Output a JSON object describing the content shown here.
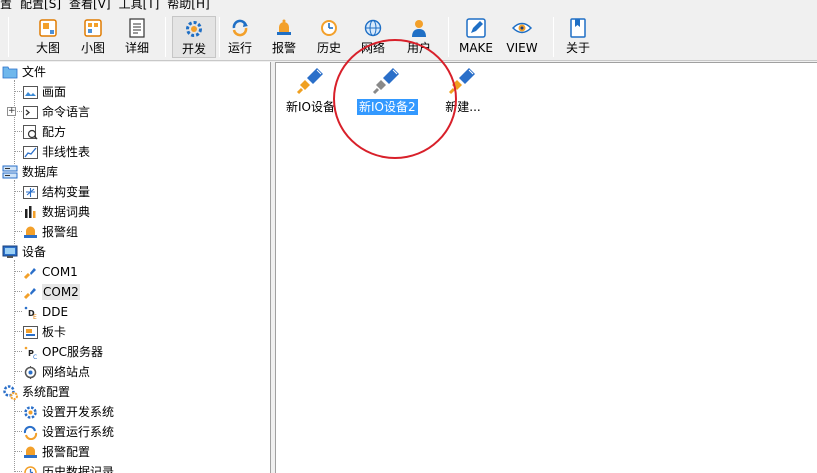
{
  "menubar": {
    "items": [
      "置",
      "配置[S]",
      "查看[V]",
      "工具[T]",
      "帮助[H]"
    ]
  },
  "toolbar": {
    "buttons": [
      {
        "label": "大图",
        "icon": "large-icons-icon"
      },
      {
        "label": "小图",
        "icon": "small-icons-icon"
      },
      {
        "label": "详细",
        "icon": "details-icon"
      },
      {
        "label": "开发",
        "icon": "develop-gear-icon"
      },
      {
        "label": "运行",
        "icon": "run-icon"
      },
      {
        "label": "报警",
        "icon": "alarm-bell-icon"
      },
      {
        "label": "历史",
        "icon": "history-clock-icon"
      },
      {
        "label": "网络",
        "icon": "network-globe-icon"
      },
      {
        "label": "用户",
        "icon": "user-icon"
      },
      {
        "label": "MAKE",
        "icon": "make-pencil-icon"
      },
      {
        "label": "VIEW",
        "icon": "view-eye-icon"
      },
      {
        "label": "关于",
        "icon": "about-book-icon"
      }
    ],
    "active": "开发"
  },
  "tree": {
    "groups": [
      {
        "label": "文件",
        "icon": "folder-icon",
        "children": [
          "画面",
          "命令语言",
          "配方",
          "非线性表"
        ]
      },
      {
        "label": "数据库",
        "icon": "database-icon",
        "children": [
          "结构变量",
          "数据词典",
          "报警组"
        ]
      },
      {
        "label": "设备",
        "icon": "device-monitor-icon",
        "children": [
          "COM1",
          "COM2",
          "DDE",
          "板卡",
          "OPC服务器",
          "网络站点"
        ]
      },
      {
        "label": "系统配置",
        "icon": "system-config-icon",
        "children": [
          "设置开发系统",
          "设置运行系统",
          "报警配置",
          "历史数据记录"
        ]
      }
    ]
  },
  "main": {
    "devices": [
      {
        "label": "新IO设备",
        "selected": false
      },
      {
        "label": "新IO设备2",
        "selected": true
      },
      {
        "label": "新建...",
        "selected": false
      }
    ]
  },
  "colors": {
    "selection": "#3399ff",
    "annotation_circle": "#d8202a",
    "plug_orange": "#f0a020",
    "plug_blue": "#2a6fc9"
  }
}
